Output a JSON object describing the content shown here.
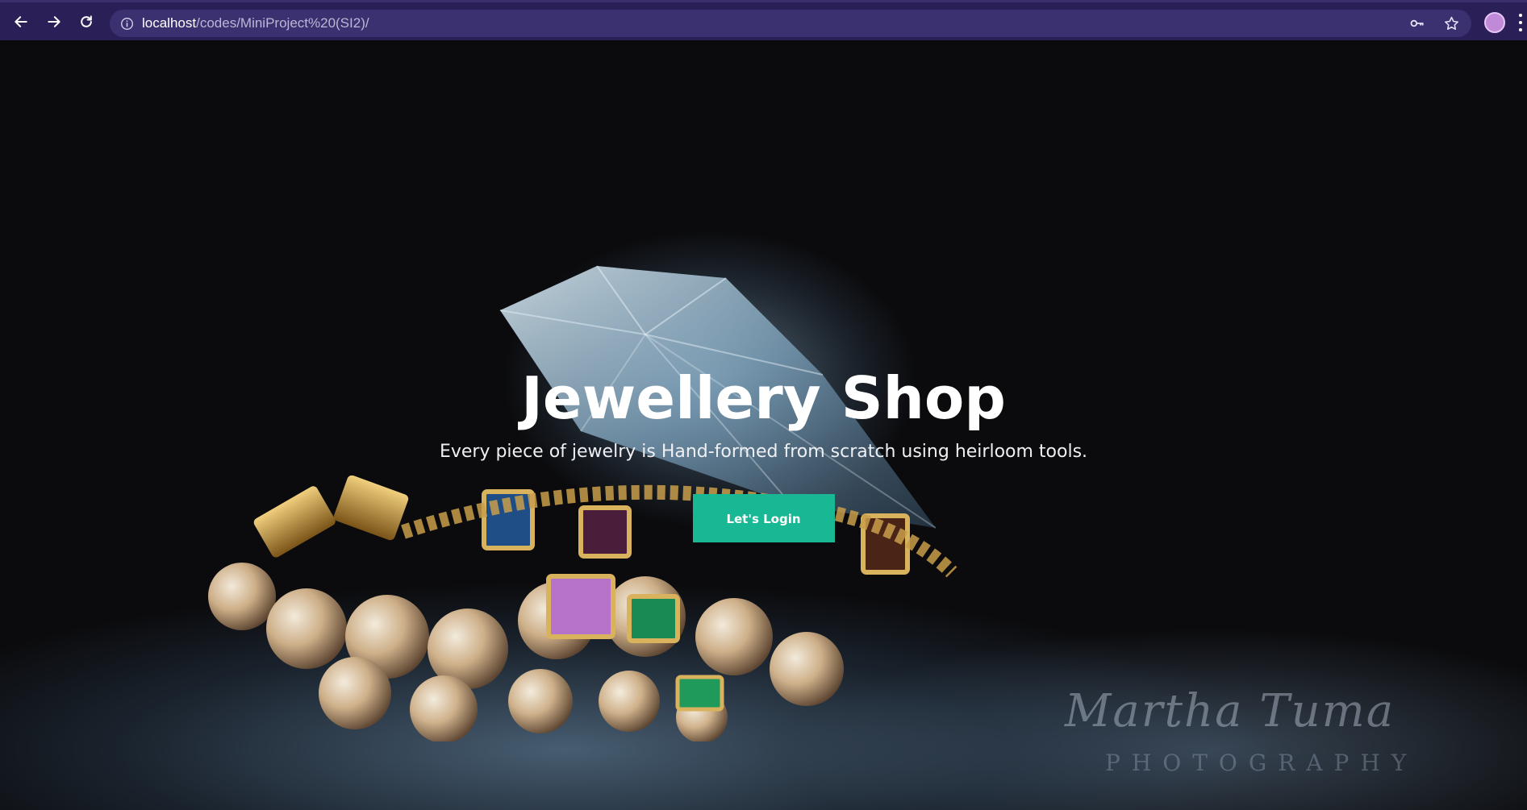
{
  "browser": {
    "url_host": "localhost",
    "url_path": "/codes/MiniProject%20(SI2)/",
    "icons": [
      "back-arrow-icon",
      "forward-arrow-icon",
      "reload-icon",
      "info-icon",
      "key-icon",
      "star-icon",
      "avatar",
      "menu-dots-icon"
    ]
  },
  "hero": {
    "title": "Jewellery Shop",
    "subtitle": "Every piece of jewelry is Hand-formed from scratch using heirloom tools.",
    "login_label": "Let's Login",
    "watermark_script": "Martha Tuma",
    "watermark_sub": "PHOTOGRAPHY",
    "colors": {
      "button": "#18b894",
      "browser_bar": "#2a1f57",
      "omnibox": "#3c3170"
    }
  }
}
